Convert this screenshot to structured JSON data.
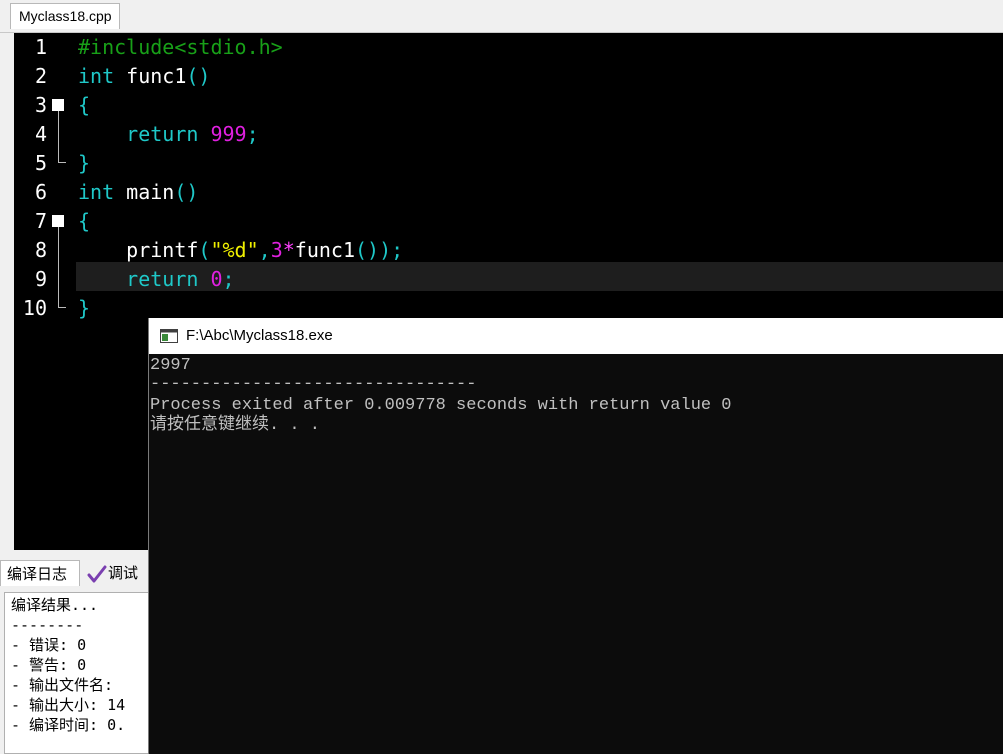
{
  "editor": {
    "tab_label": "Myclass18.cpp",
    "line_numbers": [
      "1",
      "2",
      "3",
      "4",
      "5",
      "6",
      "7",
      "8",
      "9",
      "10"
    ],
    "code": {
      "l1_pp": "#include<stdio.h>",
      "l2_kw": "int",
      "l2_fn": " func1",
      "l2_br": "()",
      "l3_br": "{",
      "l4_indent": "    ",
      "l4_kw": "return",
      "l4_num": " 999",
      "l4_semi": ";",
      "l5_br": "}",
      "l6_kw": "int",
      "l6_fn": " main",
      "l6_br": "()",
      "l7_br": "{",
      "l8_indent": "    ",
      "l8_fn": "printf",
      "l8_br1": "(",
      "l8_str": "\"%d\"",
      "l8_comma": ",",
      "l8_num": "3",
      "l8_op": "*",
      "l8_fn2": "func1",
      "l8_br2": "())",
      "l8_semi": ";",
      "l9_indent": "    ",
      "l9_kw": "return",
      "l9_num": " 0",
      "l9_semi": ";",
      "l10_br": "}"
    }
  },
  "bottom_panel": {
    "tab_compile_log": "编译日志",
    "tab_debug": "调试",
    "log_lines": [
      "编译结果...",
      "--------",
      "- 错误: 0",
      "- 警告: 0",
      "- 输出文件名:",
      "- 输出大小: 14",
      "- 编译时间: 0."
    ]
  },
  "console": {
    "title": "F:\\Abc\\Myclass18.exe",
    "lines": [
      "2997",
      "--------------------------------",
      "Process exited after 0.009778 seconds with return value 0",
      "请按任意键继续. . ."
    ]
  },
  "colors": {
    "editor_bg": "#000000",
    "preprocessor": "#18a018",
    "keyword": "#1fc8c8",
    "number": "#e020e0",
    "string": "#f0f000",
    "console_bg": "#0c0c0c",
    "console_text": "#c0c0c0"
  }
}
